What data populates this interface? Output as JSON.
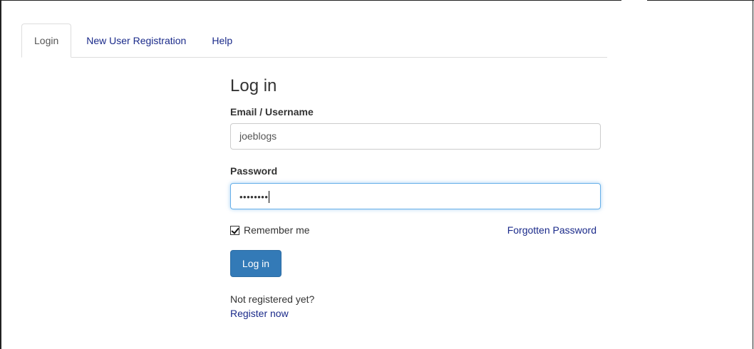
{
  "tabs": [
    {
      "label": "Login",
      "active": true
    },
    {
      "label": "New User Registration",
      "active": false
    },
    {
      "label": "Help",
      "active": false
    }
  ],
  "form": {
    "title": "Log in",
    "email_label": "Email / Username",
    "email_value": "joeblogs",
    "password_label": "Password",
    "password_masked": "••••••••",
    "remember_label": "Remember me",
    "remember_checked": true,
    "forgot_label": "Forgotten Password",
    "login_button_label": "Log in",
    "not_registered_text": "Not registered yet?",
    "register_link_label": "Register now"
  },
  "colors": {
    "link": "#1a2a8a",
    "primary_button": "#337ab7",
    "focus_border": "#66afe9"
  },
  "icons": {
    "remember_checkbox": "checkmark-icon"
  }
}
